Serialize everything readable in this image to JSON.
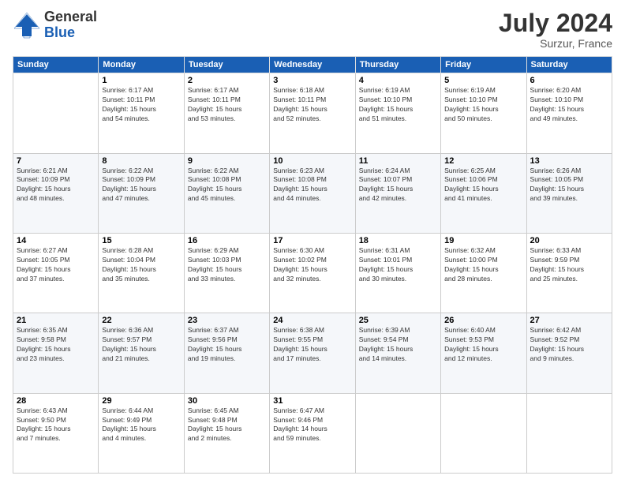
{
  "logo": {
    "general": "General",
    "blue": "Blue"
  },
  "header": {
    "month": "July 2024",
    "location": "Surzur, France"
  },
  "weekdays": [
    "Sunday",
    "Monday",
    "Tuesday",
    "Wednesday",
    "Thursday",
    "Friday",
    "Saturday"
  ],
  "weeks": [
    [
      {
        "day": "",
        "info": ""
      },
      {
        "day": "1",
        "info": "Sunrise: 6:17 AM\nSunset: 10:11 PM\nDaylight: 15 hours\nand 54 minutes."
      },
      {
        "day": "2",
        "info": "Sunrise: 6:17 AM\nSunset: 10:11 PM\nDaylight: 15 hours\nand 53 minutes."
      },
      {
        "day": "3",
        "info": "Sunrise: 6:18 AM\nSunset: 10:11 PM\nDaylight: 15 hours\nand 52 minutes."
      },
      {
        "day": "4",
        "info": "Sunrise: 6:19 AM\nSunset: 10:10 PM\nDaylight: 15 hours\nand 51 minutes."
      },
      {
        "day": "5",
        "info": "Sunrise: 6:19 AM\nSunset: 10:10 PM\nDaylight: 15 hours\nand 50 minutes."
      },
      {
        "day": "6",
        "info": "Sunrise: 6:20 AM\nSunset: 10:10 PM\nDaylight: 15 hours\nand 49 minutes."
      }
    ],
    [
      {
        "day": "7",
        "info": "Sunrise: 6:21 AM\nSunset: 10:09 PM\nDaylight: 15 hours\nand 48 minutes."
      },
      {
        "day": "8",
        "info": "Sunrise: 6:22 AM\nSunset: 10:09 PM\nDaylight: 15 hours\nand 47 minutes."
      },
      {
        "day": "9",
        "info": "Sunrise: 6:22 AM\nSunset: 10:08 PM\nDaylight: 15 hours\nand 45 minutes."
      },
      {
        "day": "10",
        "info": "Sunrise: 6:23 AM\nSunset: 10:08 PM\nDaylight: 15 hours\nand 44 minutes."
      },
      {
        "day": "11",
        "info": "Sunrise: 6:24 AM\nSunset: 10:07 PM\nDaylight: 15 hours\nand 42 minutes."
      },
      {
        "day": "12",
        "info": "Sunrise: 6:25 AM\nSunset: 10:06 PM\nDaylight: 15 hours\nand 41 minutes."
      },
      {
        "day": "13",
        "info": "Sunrise: 6:26 AM\nSunset: 10:05 PM\nDaylight: 15 hours\nand 39 minutes."
      }
    ],
    [
      {
        "day": "14",
        "info": "Sunrise: 6:27 AM\nSunset: 10:05 PM\nDaylight: 15 hours\nand 37 minutes."
      },
      {
        "day": "15",
        "info": "Sunrise: 6:28 AM\nSunset: 10:04 PM\nDaylight: 15 hours\nand 35 minutes."
      },
      {
        "day": "16",
        "info": "Sunrise: 6:29 AM\nSunset: 10:03 PM\nDaylight: 15 hours\nand 33 minutes."
      },
      {
        "day": "17",
        "info": "Sunrise: 6:30 AM\nSunset: 10:02 PM\nDaylight: 15 hours\nand 32 minutes."
      },
      {
        "day": "18",
        "info": "Sunrise: 6:31 AM\nSunset: 10:01 PM\nDaylight: 15 hours\nand 30 minutes."
      },
      {
        "day": "19",
        "info": "Sunrise: 6:32 AM\nSunset: 10:00 PM\nDaylight: 15 hours\nand 28 minutes."
      },
      {
        "day": "20",
        "info": "Sunrise: 6:33 AM\nSunset: 9:59 PM\nDaylight: 15 hours\nand 25 minutes."
      }
    ],
    [
      {
        "day": "21",
        "info": "Sunrise: 6:35 AM\nSunset: 9:58 PM\nDaylight: 15 hours\nand 23 minutes."
      },
      {
        "day": "22",
        "info": "Sunrise: 6:36 AM\nSunset: 9:57 PM\nDaylight: 15 hours\nand 21 minutes."
      },
      {
        "day": "23",
        "info": "Sunrise: 6:37 AM\nSunset: 9:56 PM\nDaylight: 15 hours\nand 19 minutes."
      },
      {
        "day": "24",
        "info": "Sunrise: 6:38 AM\nSunset: 9:55 PM\nDaylight: 15 hours\nand 17 minutes."
      },
      {
        "day": "25",
        "info": "Sunrise: 6:39 AM\nSunset: 9:54 PM\nDaylight: 15 hours\nand 14 minutes."
      },
      {
        "day": "26",
        "info": "Sunrise: 6:40 AM\nSunset: 9:53 PM\nDaylight: 15 hours\nand 12 minutes."
      },
      {
        "day": "27",
        "info": "Sunrise: 6:42 AM\nSunset: 9:52 PM\nDaylight: 15 hours\nand 9 minutes."
      }
    ],
    [
      {
        "day": "28",
        "info": "Sunrise: 6:43 AM\nSunset: 9:50 PM\nDaylight: 15 hours\nand 7 minutes."
      },
      {
        "day": "29",
        "info": "Sunrise: 6:44 AM\nSunset: 9:49 PM\nDaylight: 15 hours\nand 4 minutes."
      },
      {
        "day": "30",
        "info": "Sunrise: 6:45 AM\nSunset: 9:48 PM\nDaylight: 15 hours\nand 2 minutes."
      },
      {
        "day": "31",
        "info": "Sunrise: 6:47 AM\nSunset: 9:46 PM\nDaylight: 14 hours\nand 59 minutes."
      },
      {
        "day": "",
        "info": ""
      },
      {
        "day": "",
        "info": ""
      },
      {
        "day": "",
        "info": ""
      }
    ]
  ]
}
